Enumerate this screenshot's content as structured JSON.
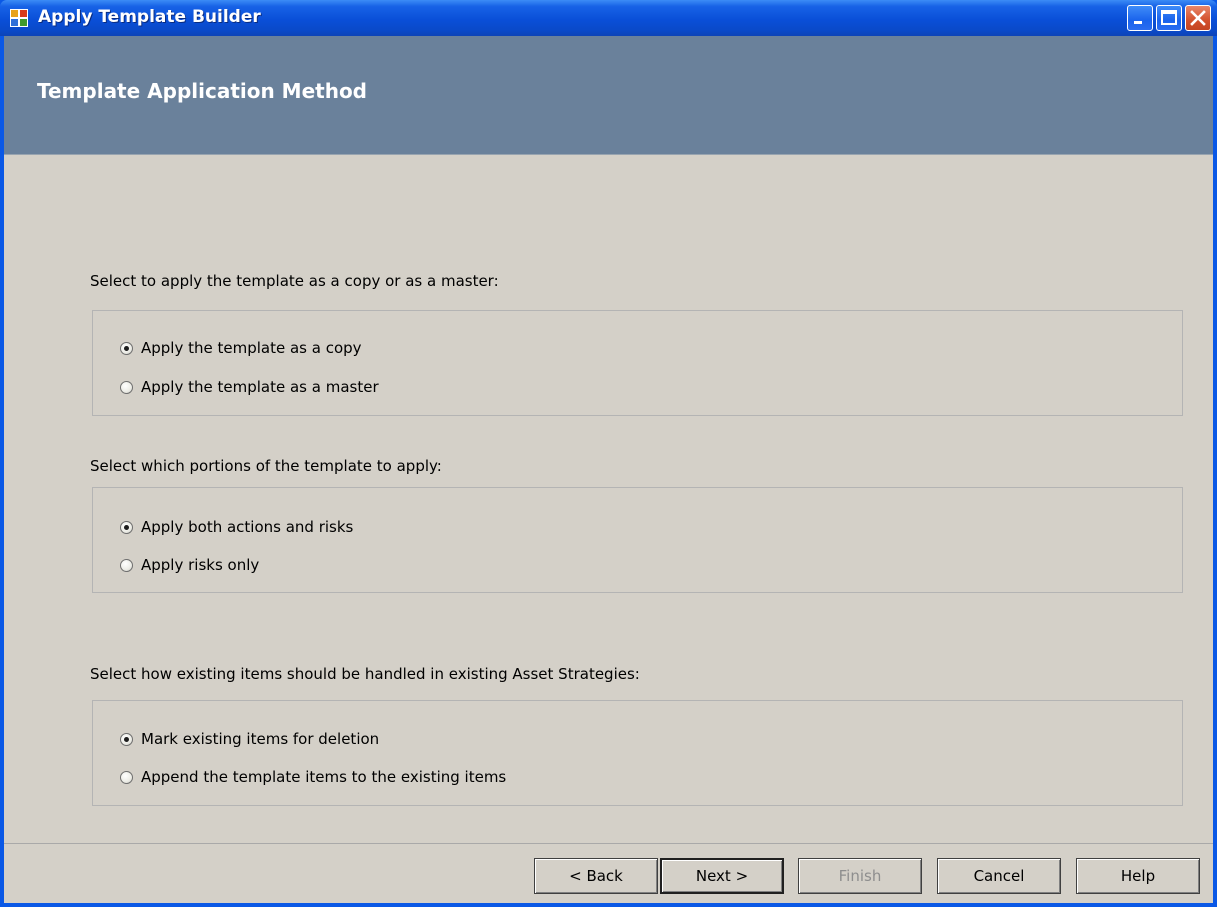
{
  "window": {
    "title": "Apply Template Builder",
    "controls": [
      "minimize-icon",
      "maximize-icon",
      "close-icon"
    ]
  },
  "header": {
    "title": "Template Application Method"
  },
  "sections": [
    {
      "prompt": "Select to apply the template as a copy or as a master:",
      "options": [
        {
          "label": "Apply the template as a copy",
          "checked": true
        },
        {
          "label": "Apply the template as a master",
          "checked": false
        }
      ]
    },
    {
      "prompt": "Select which portions of the template to apply:",
      "options": [
        {
          "label": "Apply both actions and risks",
          "checked": true
        },
        {
          "label": "Apply risks only",
          "checked": false
        }
      ]
    },
    {
      "prompt": "Select how existing items should be handled in existing Asset Strategies:",
      "options": [
        {
          "label": "Mark existing items for deletion",
          "checked": true
        },
        {
          "label": "Append the template items to the existing items",
          "checked": false
        }
      ]
    }
  ],
  "buttons": {
    "back": "< Back",
    "next": "Next >",
    "finish": "Finish",
    "cancel": "Cancel",
    "help": "Help"
  },
  "colors": {
    "titlebar": "#0a4fd8",
    "header": "#6a819b",
    "dialog_bg": "#d4d0c8"
  }
}
